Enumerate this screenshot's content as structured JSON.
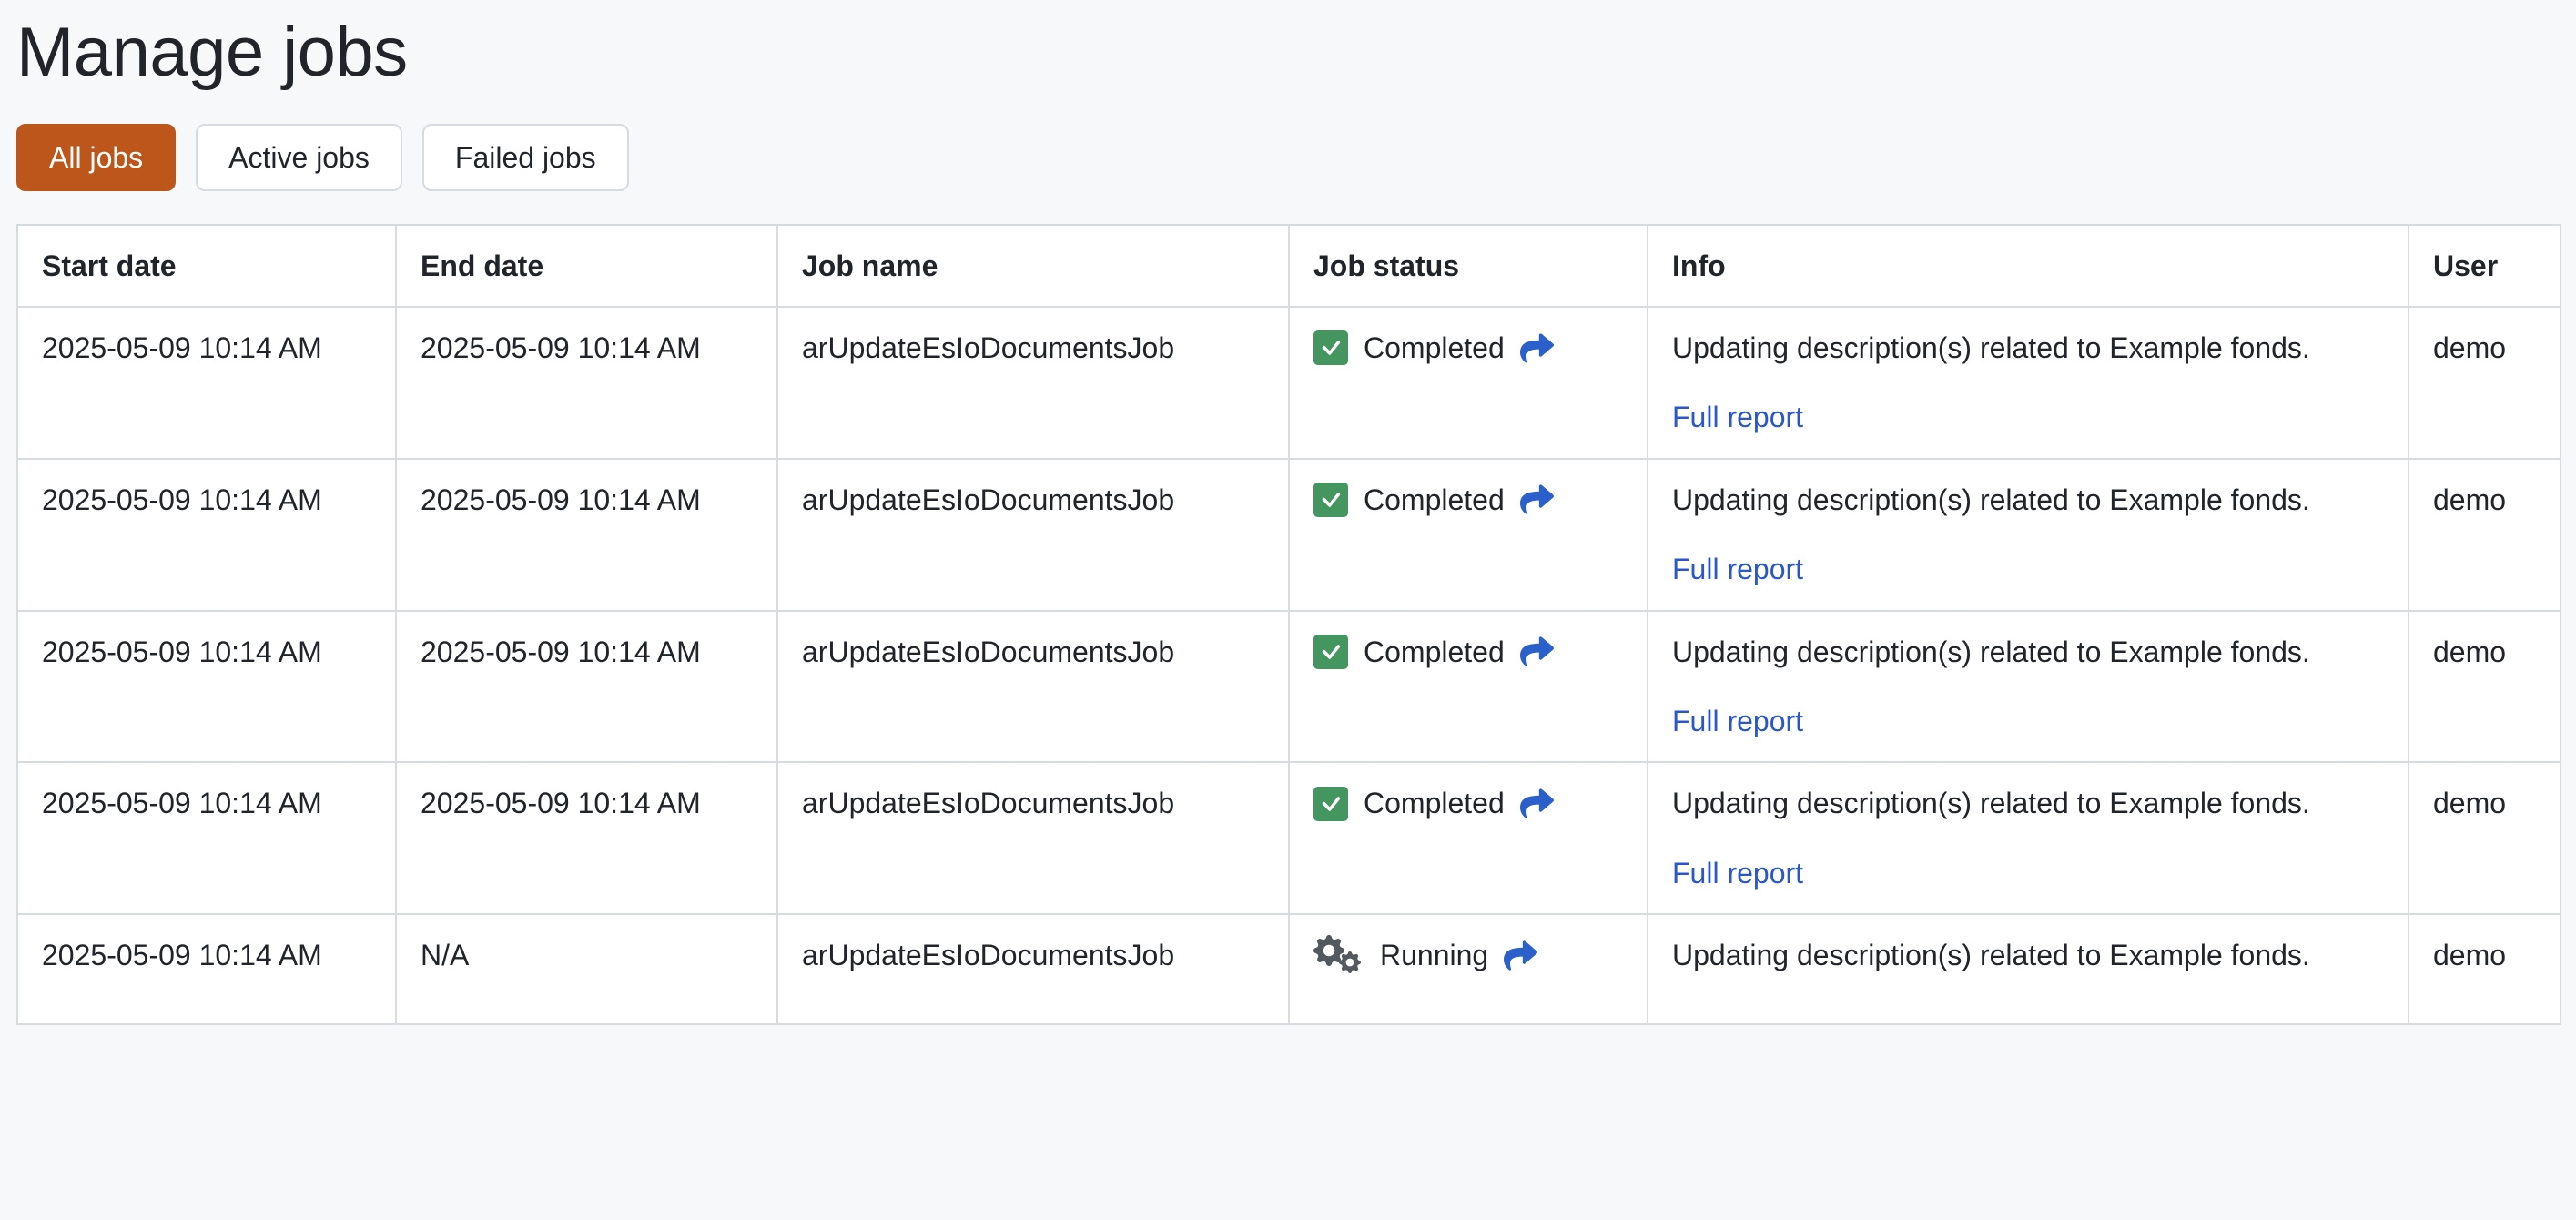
{
  "page": {
    "title": "Manage jobs"
  },
  "filters": [
    {
      "label": "All jobs",
      "active": true
    },
    {
      "label": "Active jobs",
      "active": false
    },
    {
      "label": "Failed jobs",
      "active": false
    }
  ],
  "table": {
    "columns": [
      "Start date",
      "End date",
      "Job name",
      "Job status",
      "Info",
      "User"
    ],
    "rows": [
      {
        "start_date": "2025-05-09 10:14 AM",
        "end_date": "2025-05-09 10:14 AM",
        "job_name": "arUpdateEsIoDocumentsJob",
        "status": "Completed",
        "status_icon": "check-square-icon",
        "info": "Updating description(s) related to Example fonds.",
        "report_link": "Full report",
        "user": "demo"
      },
      {
        "start_date": "2025-05-09 10:14 AM",
        "end_date": "2025-05-09 10:14 AM",
        "job_name": "arUpdateEsIoDocumentsJob",
        "status": "Completed",
        "status_icon": "check-square-icon",
        "info": "Updating description(s) related to Example fonds.",
        "report_link": "Full report",
        "user": "demo"
      },
      {
        "start_date": "2025-05-09 10:14 AM",
        "end_date": "2025-05-09 10:14 AM",
        "job_name": "arUpdateEsIoDocumentsJob",
        "status": "Completed",
        "status_icon": "check-square-icon",
        "info": "Updating description(s) related to Example fonds.",
        "report_link": "Full report",
        "user": "demo"
      },
      {
        "start_date": "2025-05-09 10:14 AM",
        "end_date": "2025-05-09 10:14 AM",
        "job_name": "arUpdateEsIoDocumentsJob",
        "status": "Completed",
        "status_icon": "check-square-icon",
        "info": "Updating description(s) related to Example fonds.",
        "report_link": "Full report",
        "user": "demo"
      },
      {
        "start_date": "2025-05-09 10:14 AM",
        "end_date": "N/A",
        "job_name": "arUpdateEsIoDocumentsJob",
        "status": "Running",
        "status_icon": "gears-icon",
        "info": "Updating description(s) related to Example fonds.",
        "report_link": null,
        "user": "demo"
      }
    ]
  },
  "colors": {
    "accent": "#bc561b",
    "link": "#2b57c8",
    "status_green": "#459560",
    "gear_gray": "#54585f",
    "arrow_blue": "#2b5fc9",
    "table_border": "#d9dcdf",
    "page_background": "#f7f8f9",
    "text": "#212529"
  }
}
